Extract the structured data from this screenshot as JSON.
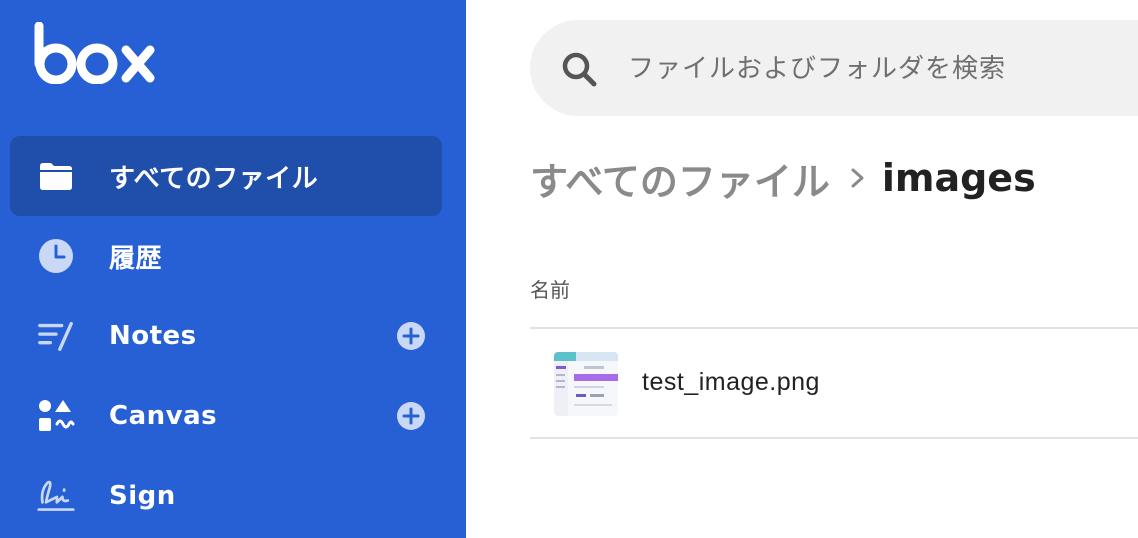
{
  "brand": {
    "logo_text": "box",
    "sidebar_color": "#2760d4",
    "active_item_color": "#1f4fab"
  },
  "sidebar": {
    "items": [
      {
        "label": "すべてのファイル",
        "icon": "folder-icon",
        "active": true,
        "has_add": false
      },
      {
        "label": "履歴",
        "icon": "clock-icon",
        "active": false,
        "has_add": false
      },
      {
        "label": "Notes",
        "icon": "notes-icon",
        "active": false,
        "has_add": true,
        "add_icon": "plus-circle-icon"
      },
      {
        "label": "Canvas",
        "icon": "canvas-shapes-icon",
        "active": false,
        "has_add": true,
        "add_icon": "plus-circle-icon"
      },
      {
        "label": "Sign",
        "icon": "signature-icon",
        "active": false,
        "has_add": false
      }
    ]
  },
  "search": {
    "placeholder": "ファイルおよびフォルダを検索",
    "value": "",
    "icon": "search-icon"
  },
  "breadcrumb": {
    "root": "すべてのファイル",
    "separator_icon": "chevron-right-icon",
    "current": "images"
  },
  "file_list": {
    "columns": [
      "名前"
    ],
    "rows": [
      {
        "name": "test_image.png",
        "thumbnail": "image-thumbnail"
      }
    ]
  }
}
